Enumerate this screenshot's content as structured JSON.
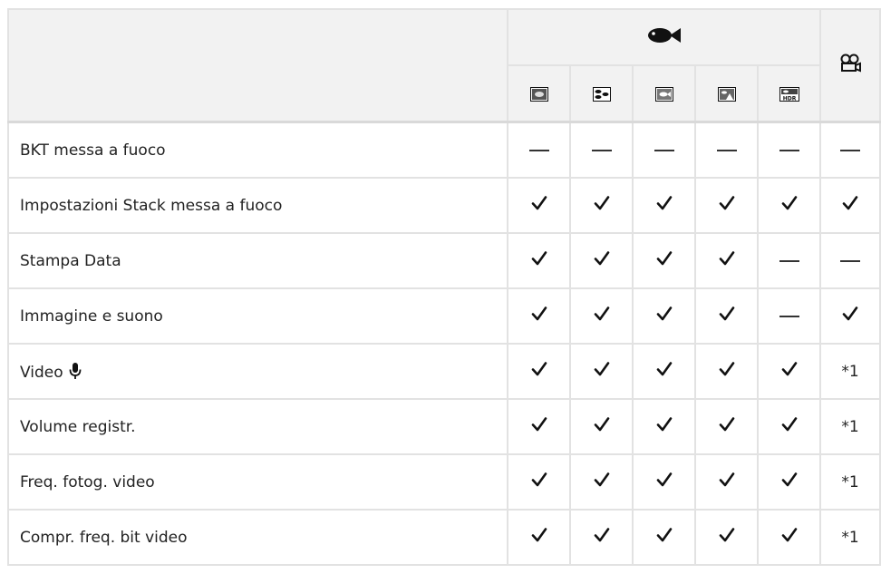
{
  "header": {
    "group_icon": "fish-icon",
    "movie_icon": "movie-camera-icon",
    "mode_icons": [
      "underwater-wide-mode-icon",
      "underwater-macro-mode-icon",
      "underwater-snapshot-mode-icon",
      "underwater-landscape-mode-icon",
      "underwater-hdr-mode-icon"
    ]
  },
  "rows": [
    {
      "label": "BKT messa a fuoco",
      "cells": [
        "dash",
        "dash",
        "dash",
        "dash",
        "dash",
        "dash"
      ]
    },
    {
      "label": "Impostazioni Stack messa a fuoco",
      "cells": [
        "check",
        "check",
        "check",
        "check",
        "check",
        "check"
      ]
    },
    {
      "label": "Stampa Data",
      "cells": [
        "check",
        "check",
        "check",
        "check",
        "dash",
        "dash"
      ]
    },
    {
      "label": "Immagine e suono",
      "cells": [
        "check",
        "check",
        "check",
        "check",
        "dash",
        "check"
      ]
    },
    {
      "label": "Video",
      "label_icon": "microphone-icon",
      "cells": [
        "check",
        "check",
        "check",
        "check",
        "check",
        "*1"
      ]
    },
    {
      "label": "Volume registr.",
      "cells": [
        "check",
        "check",
        "check",
        "check",
        "check",
        "*1"
      ]
    },
    {
      "label": "Freq. fotog. video",
      "cells": [
        "check",
        "check",
        "check",
        "check",
        "check",
        "*1"
      ]
    },
    {
      "label": "Compr. freq. bit video",
      "cells": [
        "check",
        "check",
        "check",
        "check",
        "check",
        "*1"
      ]
    }
  ]
}
